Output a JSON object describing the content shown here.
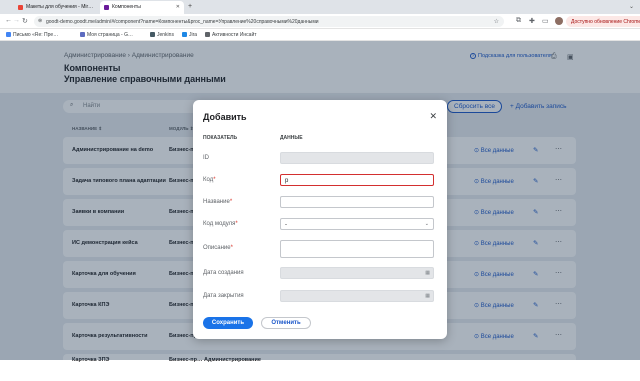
{
  "browser": {
    "tabs": [
      {
        "label": "Макеты для обучения - Mir…",
        "favicon_color": "#ea4335",
        "active": false
      },
      {
        "label": "Компоненты",
        "favicon_color": "#6a1b9a",
        "active": true
      }
    ],
    "new_tab": "+",
    "url": "goodt-demo.goodt.me/admin/#/component?name=Компоненты&proc_name=Управление%20справочными%20данными",
    "update_button": "Доступно обновление Chrome",
    "bookmarks": [
      {
        "label": "Письмо «Re: Пре…",
        "color": "#4285f4"
      },
      {
        "label": "Моя страница - G…",
        "color": "#5c6bc0"
      },
      {
        "label": "Jenkins",
        "color": "#455a64"
      },
      {
        "label": "Jira",
        "color": "#1e88e5"
      },
      {
        "label": "Активности Инсайт",
        "color": "#5f6368"
      }
    ]
  },
  "header": {
    "breadcrumb": "Администрирование  ›  Администрирование",
    "title1": "Компоненты",
    "title2": "Управление справочными данными",
    "hint_link": "Подсказка для пользователя",
    "icons": [
      "print-icon",
      "save-icon"
    ]
  },
  "toolbar": {
    "search_placeholder": "Найти",
    "reset_button": "Сбросить все",
    "add_button": "+ Добавить запись"
  },
  "table": {
    "columns": [
      "НАЗВАНИЕ ⇕",
      "МОДУЛЬ ⇕"
    ],
    "rows": [
      {
        "name": "Администрирование на demo",
        "module": "Бизнес-пр…",
        "link": "Все данные"
      },
      {
        "name": "Задача типового плана адаптации",
        "module": "Бизнес-пр…",
        "link": "Все данные"
      },
      {
        "name": "Заявки в компании",
        "module": "Бизнес-пр…",
        "link": "Все данные"
      },
      {
        "name": "ИС демонстрация кейса",
        "module": "Бизнес-пр…",
        "link": "Все данные"
      },
      {
        "name": "Карточка для обучения",
        "module": "Бизнес-пр…",
        "link": "Все данные"
      },
      {
        "name": "Карточка КПЭ",
        "module": "Бизнес-пр…",
        "link": "Все данные"
      },
      {
        "name": "Карточка результативности",
        "module": "Бизнес-пр…",
        "link": "Все данные"
      },
      {
        "name": "Карточка ЗПЭ",
        "module": "Бизнес-пр… Администрирование",
        "link": "Все данные"
      }
    ]
  },
  "modal": {
    "title": "Добавить",
    "col_indicator": "ПОКАЗАТЕЛЬ",
    "col_data": "ДАННЫЕ",
    "fields": [
      {
        "label": "ID",
        "required": false,
        "value": ""
      },
      {
        "label": "Код",
        "required": true,
        "value": "р"
      },
      {
        "label": "Название",
        "required": true,
        "value": ""
      },
      {
        "label": "Код модуля",
        "required": true,
        "value": "-"
      },
      {
        "label": "Описание",
        "required": true,
        "value": ""
      },
      {
        "label": "Дата создания",
        "required": false,
        "value": ""
      },
      {
        "label": "Дата закрытия",
        "required": false,
        "value": ""
      }
    ],
    "required_mark": "*",
    "save_button": "Сохранить",
    "cancel_button": "Отменить"
  }
}
